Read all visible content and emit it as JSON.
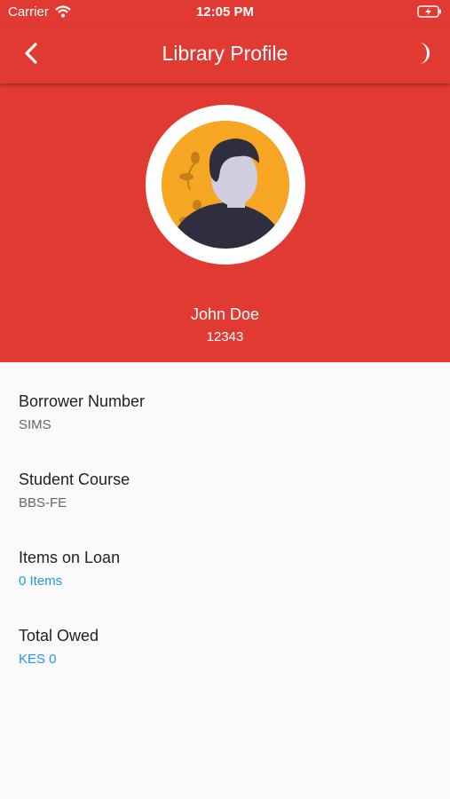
{
  "status_bar": {
    "carrier": "Carrier",
    "time": "12:05 PM"
  },
  "app_bar": {
    "title": "Library Profile"
  },
  "profile": {
    "name": "John Doe",
    "id": "12343"
  },
  "details": [
    {
      "label": "Borrower Number",
      "value": "SIMS"
    },
    {
      "label": "Student Course",
      "value": "BBS-FE"
    },
    {
      "label": "Items on Loan",
      "value": "0 Items"
    },
    {
      "label": "Total Owed",
      "value": "KES 0"
    }
  ],
  "colors": {
    "primary": "#e03a33",
    "link": "#2196f3",
    "avatar_bg": "#f6a623"
  }
}
